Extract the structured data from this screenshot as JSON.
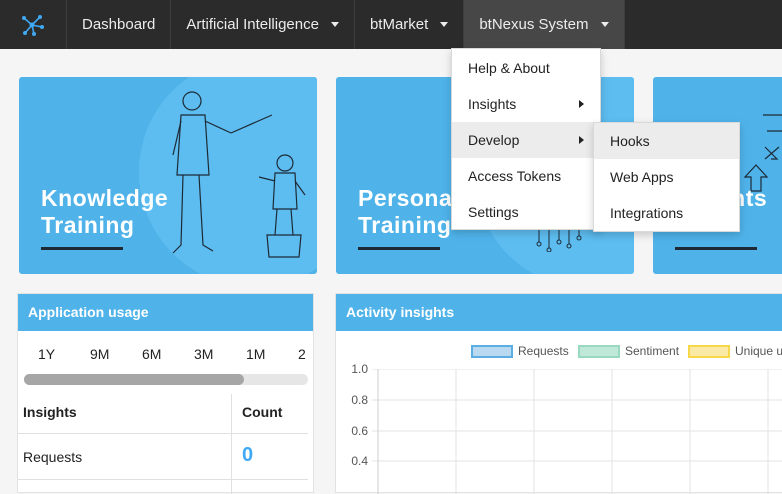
{
  "nav": {
    "items": [
      {
        "label": "Dashboard"
      },
      {
        "label": "Artificial Intelligence"
      },
      {
        "label": "btMarket"
      },
      {
        "label": "btNexus System"
      }
    ]
  },
  "cards": [
    {
      "line1": "Knowledge",
      "line2": "Training"
    },
    {
      "line1": "Persona",
      "line2": "Training"
    },
    {
      "line1": "",
      "line2": "Insights"
    }
  ],
  "app_usage": {
    "title": "Application usage",
    "ranges": [
      "1Y",
      "9M",
      "6M",
      "3M",
      "1M",
      "2"
    ],
    "col_insights": "Insights",
    "col_count": "Count",
    "rows": [
      {
        "name": "Requests",
        "count": "0"
      }
    ]
  },
  "activity": {
    "title": "Activity insights",
    "legend": [
      {
        "label": "Requests",
        "color": "#b8d9f0",
        "border": "#5aaee3"
      },
      {
        "label": "Sentiment",
        "color": "#bfe8d9",
        "border": "#9ad9c1"
      },
      {
        "label": "Unique u",
        "color": "#fbe9a6",
        "border": "#f7d84a"
      }
    ],
    "yticks": [
      "1.0",
      "0.8",
      "0.6",
      "0.4"
    ]
  },
  "menu": {
    "items": [
      "Help & About",
      "Insights",
      "Develop",
      "Access Tokens",
      "Settings"
    ],
    "sub_items": [
      "Hooks",
      "Web Apps",
      "Integrations"
    ]
  }
}
